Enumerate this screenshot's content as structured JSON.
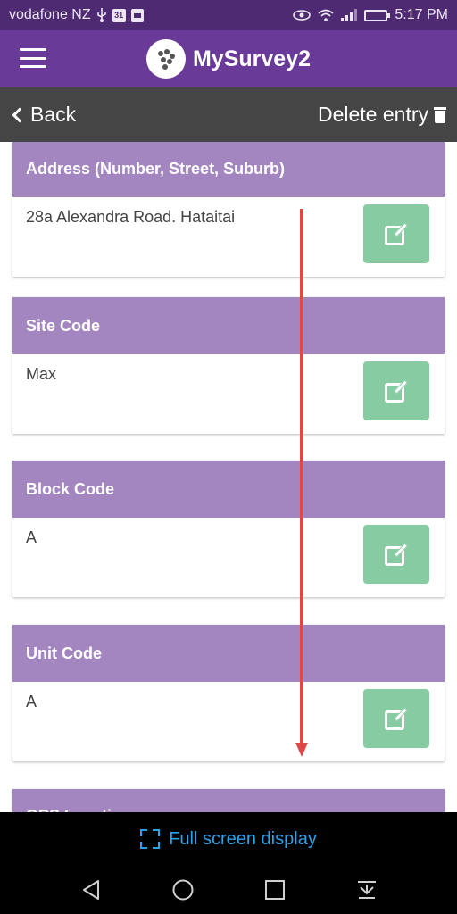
{
  "status_bar": {
    "carrier": "vodafone NZ",
    "calendar_day": "31",
    "time": "5:17 PM",
    "battery_level": 0.8,
    "icons": [
      "usb-icon",
      "calendar-icon",
      "sd-card-icon",
      "eye-icon",
      "wifi-icon",
      "signal-icon",
      "battery-icon"
    ]
  },
  "app_bar": {
    "title": "MySurvey2"
  },
  "sub_bar": {
    "back_label": "Back",
    "delete_label": "Delete entry"
  },
  "cards": [
    {
      "title": "Address (Number, Street, Suburb)",
      "value": "28a Alexandra Road. Hataitai"
    },
    {
      "title": "Site Code",
      "value": "Max"
    },
    {
      "title": "Block Code",
      "value": "A"
    },
    {
      "title": "Unit Code",
      "value": "A"
    },
    {
      "title": "GPS Location",
      "value": ""
    }
  ],
  "full_screen": {
    "label": "Full screen display"
  },
  "colors": {
    "status_bar": "#4e2a73",
    "app_bar": "#6a3a98",
    "sub_bar": "#454545",
    "card_header": "#a385c0",
    "edit_button": "#86cba2",
    "scroll_arrow": "#e04848",
    "full_screen_text": "#29a3ee"
  }
}
